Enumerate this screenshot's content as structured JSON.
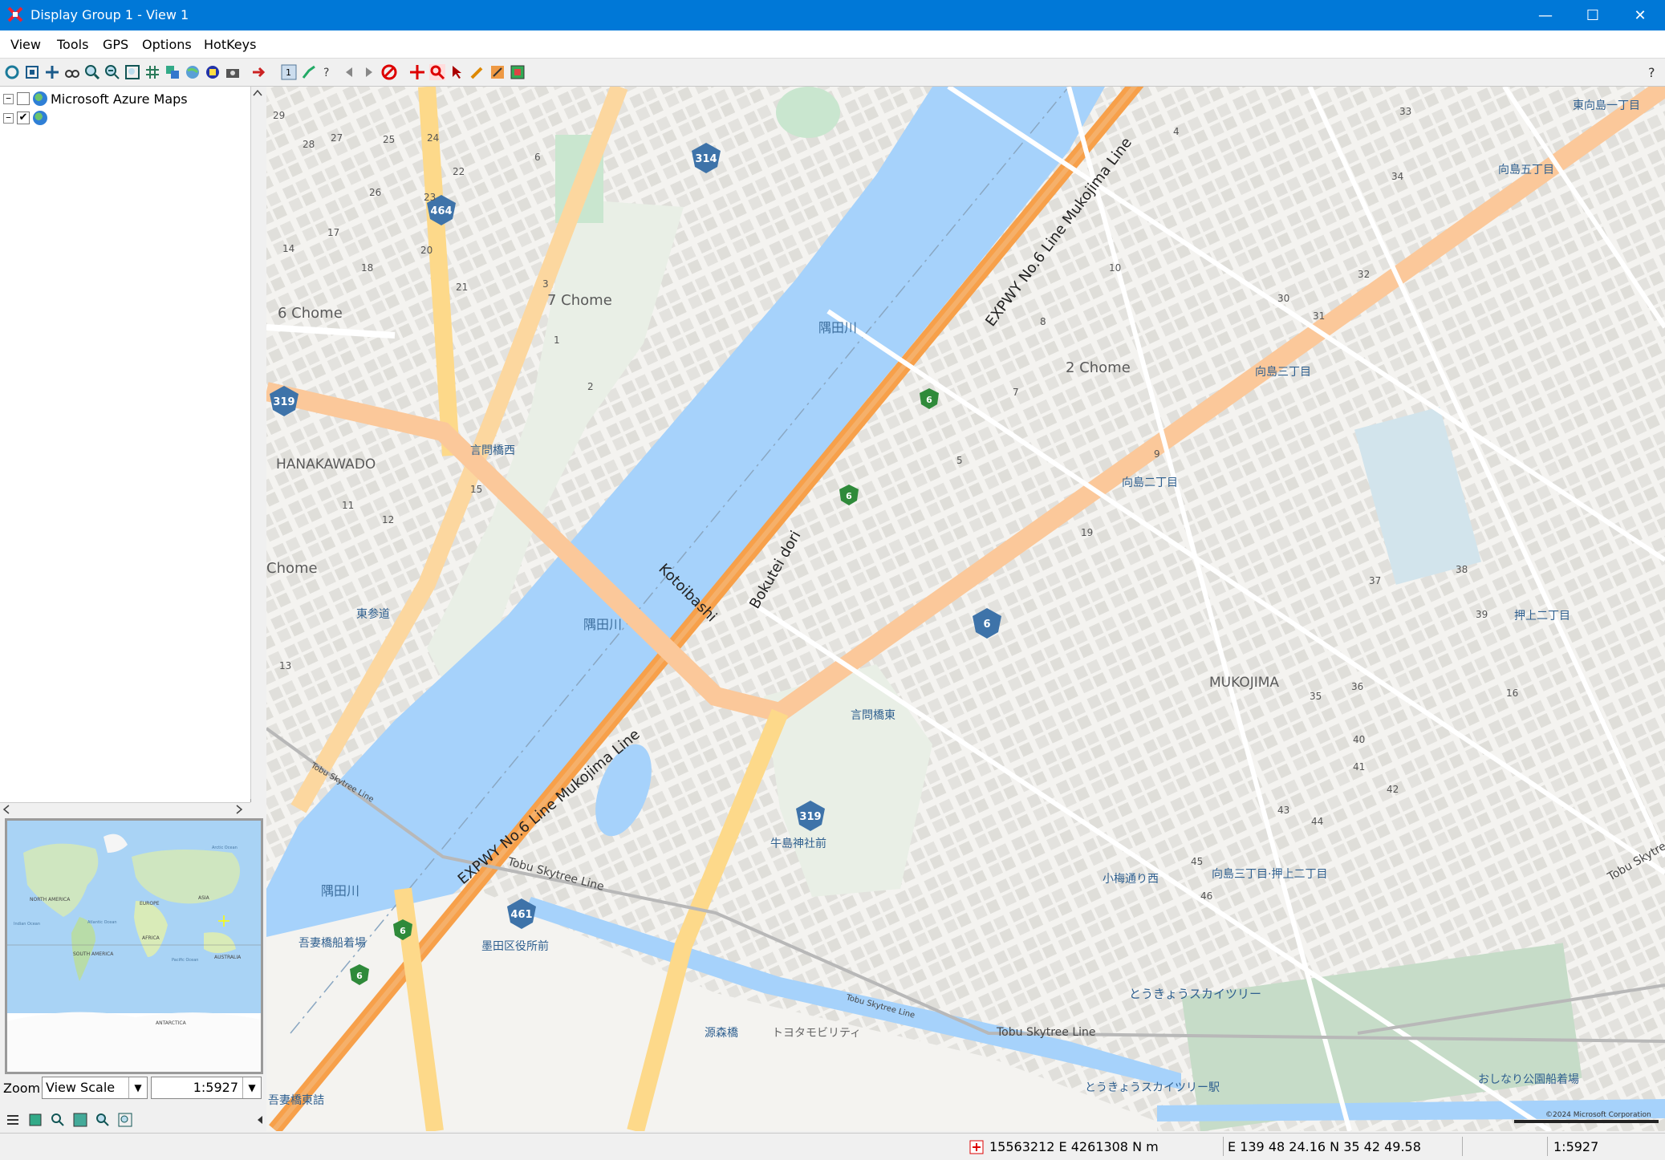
{
  "window": {
    "title": "Display Group 1 - View 1",
    "minimize": "—",
    "maximize": "☐",
    "close": "✕"
  },
  "menu": [
    "View",
    "Tools",
    "GPS",
    "Options",
    "HotKeys"
  ],
  "toolbar_icons": [
    "refresh-icon",
    "frame-icon",
    "pan-icon",
    "binoculars-icon",
    "zoom-in-icon",
    "zoom-out-icon",
    "zoom-extent-icon",
    "grid-icon",
    "layers-icon",
    "globe-icon",
    "map-icon",
    "camera-icon",
    "arrow-icon",
    "select-1-icon",
    "route-icon",
    "help-cursor-icon",
    "back-icon",
    "forward-icon",
    "stop-icon",
    "move-icon",
    "magnifier-red-icon",
    "pointer-icon",
    "pencil-icon",
    "edit-icon",
    "image-icon",
    "help-icon"
  ],
  "layers": {
    "items": [
      {
        "label": "Microsoft Azure Maps",
        "expander": "−",
        "checked": false
      },
      {
        "label": "",
        "expander": "−",
        "checked": true
      }
    ]
  },
  "overview": {
    "labels": [
      "NORTH AMERICA",
      "EUROPE",
      "ASIA",
      "AFRICA",
      "SOUTH AMERICA",
      "AUSTRALIA",
      "ANTARCTICA",
      "Atlantic Ocean",
      "Pacific Ocean",
      "Indian Ocean",
      "Arctic Ocean"
    ]
  },
  "zoom": {
    "label": "Zoom",
    "mode": "View Scale",
    "scale": "1:5927"
  },
  "map": {
    "areas": [
      "6 Chome",
      "7 Chome",
      "2 Chome",
      "HANAKAWADO",
      "MUKOJIMA",
      "Chome"
    ],
    "rivers": [
      "隅田川",
      "隅田川",
      "隅田川"
    ],
    "roads": [
      "EXPWY No.6 Line Mukojima Line",
      "EXPWY No.6 Line Mukojima Line",
      "Bokutei dori",
      "Kotoibashi",
      "Tobu Skytree Line",
      "Tobu Skytree Line",
      "Tobu Skytree Line",
      "Tobu Skytree Line",
      "Tobu Skytree"
    ],
    "places": [
      "言問橋西",
      "言問橋東",
      "東参道",
      "牛島神社前",
      "墨田区役所前",
      "吾妻橋船着場",
      "東向島一丁目",
      "向島五丁目",
      "向島三丁目",
      "向島二丁目",
      "押上二丁目",
      "向島三丁目·押上二丁目",
      "小梅通り西",
      "とうきょうスカイツリー",
      "とうきょうスカイツリー駅",
      "おしなり公園船着場",
      "源森橋",
      "トヨタモビリティ",
      "吾妻橋東詰"
    ],
    "shields": [
      "314",
      "464",
      "319",
      "6",
      "6",
      "6",
      "319",
      "461",
      "6",
      "6"
    ],
    "numbers": [
      "29",
      "28",
      "27",
      "25",
      "24",
      "22",
      "26",
      "23",
      "17",
      "14",
      "18",
      "20",
      "21",
      "3",
      "6",
      "4",
      "1",
      "5",
      "2",
      "33",
      "15",
      "11",
      "12",
      "13",
      "19",
      "16",
      "10",
      "7",
      "8",
      "9",
      "30",
      "31",
      "32",
      "34",
      "35",
      "36",
      "37",
      "38",
      "39",
      "40",
      "41",
      "42",
      "43",
      "44",
      "45",
      "46"
    ],
    "copyright": "©2024 Microsoft Corporation"
  },
  "status": {
    "coords_utm": "15563212 E  4261308 N m",
    "coords_geo": "E 139 48 24.16  N 35 42 49.58",
    "scale": "1:5927"
  }
}
